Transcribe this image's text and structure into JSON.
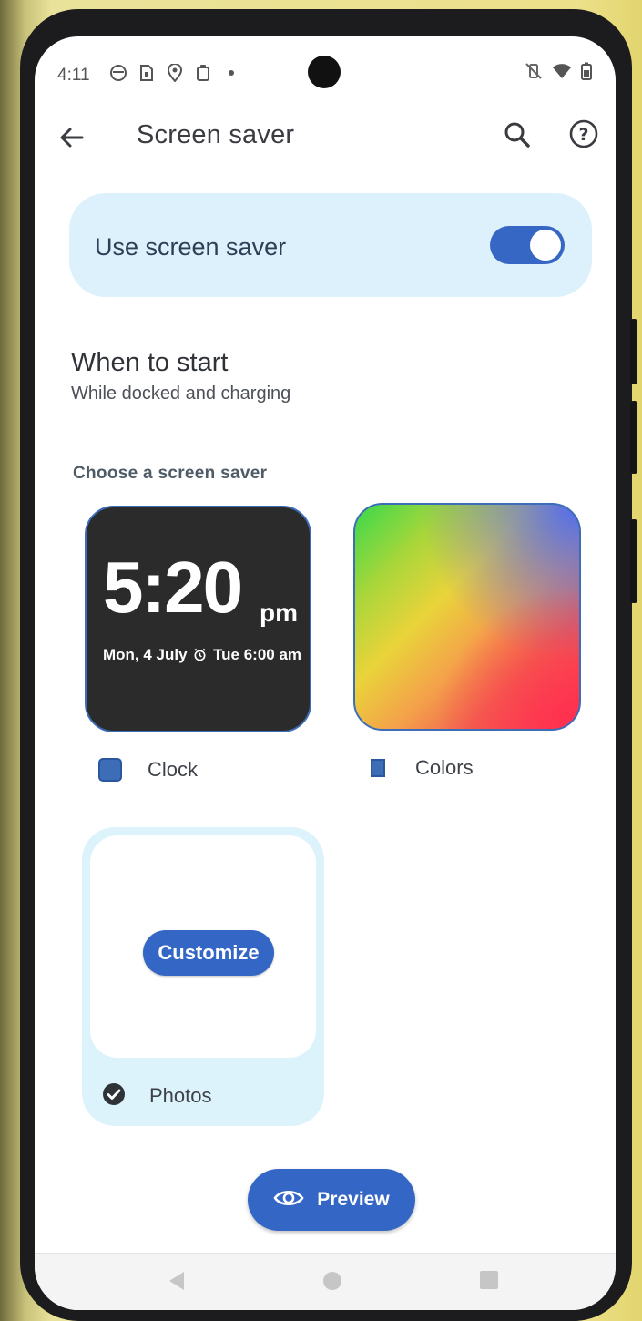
{
  "status_bar": {
    "time": "4:11",
    "left_icons": [
      "notification-icon",
      "sim-icon",
      "location-icon",
      "clipboard-icon",
      "dot-icon"
    ],
    "right_icons": [
      "vibrate-off-icon",
      "wifi-icon",
      "battery-icon"
    ]
  },
  "app_bar": {
    "title": "Screen saver",
    "back_icon": "arrow-back-icon",
    "search_icon": "search-icon",
    "help_icon": "help-icon"
  },
  "toggle": {
    "label": "Use screen saver",
    "enabled": true
  },
  "when_to_start": {
    "title": "When to start",
    "value": "While docked and charging"
  },
  "choose_header": "Choose a screen saver",
  "clock_preview": {
    "time": "5:20",
    "ampm": "pm",
    "date": "Mon, 4 July",
    "alarm": "Tue 6:00 am"
  },
  "options": [
    {
      "name": "Clock",
      "selected": false
    },
    {
      "name": "Colors",
      "selected": false
    },
    {
      "name": "Photos",
      "selected": true
    }
  ],
  "customize_label": "Customize",
  "preview_label": "Preview",
  "nav": [
    "back-nav-icon",
    "home-nav-icon",
    "recents-nav-icon"
  ],
  "colors": {
    "accent": "#3466c5",
    "card_bg": "#dcf1fb"
  }
}
